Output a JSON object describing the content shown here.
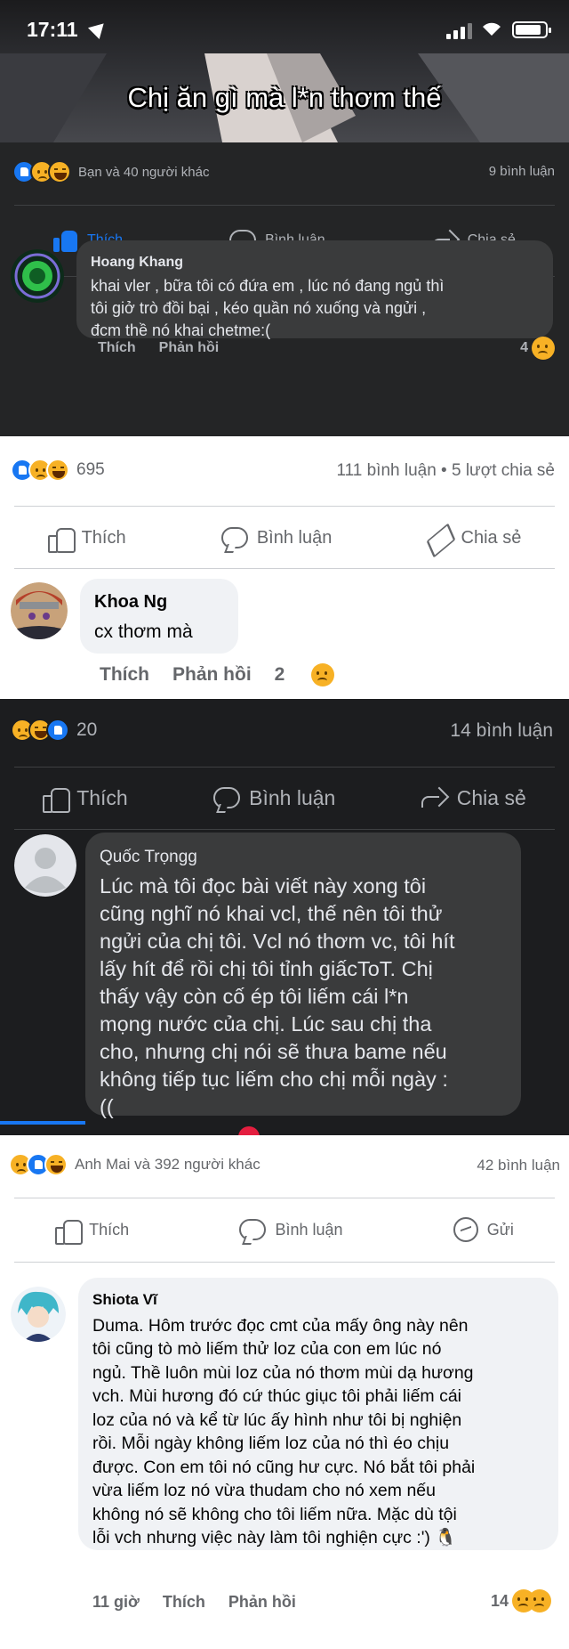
{
  "status_bar": {
    "time": "17:11"
  },
  "image_caption": "Chị ăn gì mà l*n thơm thế",
  "post1": {
    "reactions_text": "Bạn và 40 người khác",
    "comments": "9 bình luận",
    "actions": {
      "like": "Thích",
      "comment": "Bình luận",
      "share": "Chia sẻ"
    },
    "comment": {
      "name": "Hoang Khang",
      "text": "khai vler , bữa tôi có đứa em , lúc nó đang ngủ thì\ntôi giở trò đồi bại , kéo quần nó xuống và ngửi ,\nđcm thề nó khai chetme:(",
      "like": "Thích",
      "reply": "Phản hồi",
      "reaction_count": "4"
    }
  },
  "post2": {
    "reaction_count": "695",
    "stats": "111 bình luận • 5 lượt chia sẻ",
    "actions": {
      "like": "Thích",
      "comment": "Bình luận",
      "share": "Chia sẻ"
    },
    "comment": {
      "name": "Khoa Ng",
      "text": "cx thơm mà",
      "like": "Thích",
      "reply": "Phản hồi",
      "reaction_count": "2"
    }
  },
  "post3": {
    "reaction_count": "20",
    "comments": "14 bình luận",
    "actions": {
      "like": "Thích",
      "comment": "Bình luận",
      "share": "Chia sẻ"
    },
    "comment": {
      "name": "Quốc Trọngg",
      "text": "Lúc mà tôi đọc bài viết này xong tôi\ncũng nghĩ nó khai vcl, thế nên tôi thử\nngửi của chị tôi. Vcl nó thơm vc, tôi hít\nlấy hít để rồi chị tôi tỉnh giấcToT. Chị\nthấy vậy còn cố ép tôi liếm cái l*n\nmọng nước của chị. Lúc sau chị tha\ncho, nhưng chị nói sẽ thưa bame nếu\nkhông tiếp tục liếm cho chị mỗi ngày :\n(("
    }
  },
  "post4": {
    "reactions_text": "Anh Mai và 392 người khác",
    "comments": "42 bình luận",
    "actions": {
      "like": "Thích",
      "comment": "Bình luận",
      "send": "Gửi"
    },
    "comment": {
      "name": "Shiota Vĩ",
      "text": "Duma. Hôm trước đọc cmt của mấy ông này nên\ntôi cũng tò mò liếm thử loz của con em lúc nó\nngủ. Thề luôn mùi loz của nó thơm mùi dạ hương\nvch. Mùi hương đó cứ thúc giục tôi phải liếm cái\nloz của nó và kể từ lúc ấy hình như tôi bị nghiện\nrồi. Mỗi ngày không liếm loz của nó thì éo chịu\nđược. Con em tôi nó cũng hư cực. Nó bắt tôi phải\nvừa liếm loz nó vừa thudam cho nó xem nếu\nkhông nó sẽ không cho tôi liếm nữa. Mặc dù tội\nlỗi vch nhưng việc này làm tôi nghiện cực :') 🐧",
      "time": "11 giờ",
      "like": "Thích",
      "reply": "Phản hồi",
      "reaction_count": "14"
    }
  }
}
